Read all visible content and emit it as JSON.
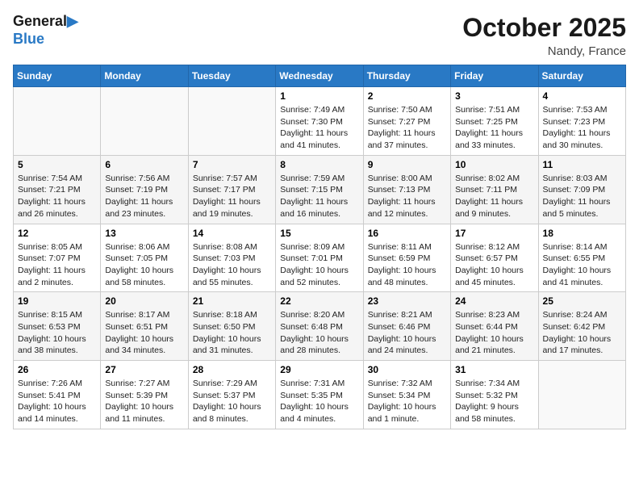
{
  "logo": {
    "line1": "General",
    "line2": "Blue"
  },
  "title": "October 2025",
  "subtitle": "Nandy, France",
  "days_header": [
    "Sunday",
    "Monday",
    "Tuesday",
    "Wednesday",
    "Thursday",
    "Friday",
    "Saturday"
  ],
  "weeks": [
    [
      {
        "day": "",
        "info": ""
      },
      {
        "day": "",
        "info": ""
      },
      {
        "day": "",
        "info": ""
      },
      {
        "day": "1",
        "info": "Sunrise: 7:49 AM\nSunset: 7:30 PM\nDaylight: 11 hours and 41 minutes."
      },
      {
        "day": "2",
        "info": "Sunrise: 7:50 AM\nSunset: 7:27 PM\nDaylight: 11 hours and 37 minutes."
      },
      {
        "day": "3",
        "info": "Sunrise: 7:51 AM\nSunset: 7:25 PM\nDaylight: 11 hours and 33 minutes."
      },
      {
        "day": "4",
        "info": "Sunrise: 7:53 AM\nSunset: 7:23 PM\nDaylight: 11 hours and 30 minutes."
      }
    ],
    [
      {
        "day": "5",
        "info": "Sunrise: 7:54 AM\nSunset: 7:21 PM\nDaylight: 11 hours and 26 minutes."
      },
      {
        "day": "6",
        "info": "Sunrise: 7:56 AM\nSunset: 7:19 PM\nDaylight: 11 hours and 23 minutes."
      },
      {
        "day": "7",
        "info": "Sunrise: 7:57 AM\nSunset: 7:17 PM\nDaylight: 11 hours and 19 minutes."
      },
      {
        "day": "8",
        "info": "Sunrise: 7:59 AM\nSunset: 7:15 PM\nDaylight: 11 hours and 16 minutes."
      },
      {
        "day": "9",
        "info": "Sunrise: 8:00 AM\nSunset: 7:13 PM\nDaylight: 11 hours and 12 minutes."
      },
      {
        "day": "10",
        "info": "Sunrise: 8:02 AM\nSunset: 7:11 PM\nDaylight: 11 hours and 9 minutes."
      },
      {
        "day": "11",
        "info": "Sunrise: 8:03 AM\nSunset: 7:09 PM\nDaylight: 11 hours and 5 minutes."
      }
    ],
    [
      {
        "day": "12",
        "info": "Sunrise: 8:05 AM\nSunset: 7:07 PM\nDaylight: 11 hours and 2 minutes."
      },
      {
        "day": "13",
        "info": "Sunrise: 8:06 AM\nSunset: 7:05 PM\nDaylight: 10 hours and 58 minutes."
      },
      {
        "day": "14",
        "info": "Sunrise: 8:08 AM\nSunset: 7:03 PM\nDaylight: 10 hours and 55 minutes."
      },
      {
        "day": "15",
        "info": "Sunrise: 8:09 AM\nSunset: 7:01 PM\nDaylight: 10 hours and 52 minutes."
      },
      {
        "day": "16",
        "info": "Sunrise: 8:11 AM\nSunset: 6:59 PM\nDaylight: 10 hours and 48 minutes."
      },
      {
        "day": "17",
        "info": "Sunrise: 8:12 AM\nSunset: 6:57 PM\nDaylight: 10 hours and 45 minutes."
      },
      {
        "day": "18",
        "info": "Sunrise: 8:14 AM\nSunset: 6:55 PM\nDaylight: 10 hours and 41 minutes."
      }
    ],
    [
      {
        "day": "19",
        "info": "Sunrise: 8:15 AM\nSunset: 6:53 PM\nDaylight: 10 hours and 38 minutes."
      },
      {
        "day": "20",
        "info": "Sunrise: 8:17 AM\nSunset: 6:51 PM\nDaylight: 10 hours and 34 minutes."
      },
      {
        "day": "21",
        "info": "Sunrise: 8:18 AM\nSunset: 6:50 PM\nDaylight: 10 hours and 31 minutes."
      },
      {
        "day": "22",
        "info": "Sunrise: 8:20 AM\nSunset: 6:48 PM\nDaylight: 10 hours and 28 minutes."
      },
      {
        "day": "23",
        "info": "Sunrise: 8:21 AM\nSunset: 6:46 PM\nDaylight: 10 hours and 24 minutes."
      },
      {
        "day": "24",
        "info": "Sunrise: 8:23 AM\nSunset: 6:44 PM\nDaylight: 10 hours and 21 minutes."
      },
      {
        "day": "25",
        "info": "Sunrise: 8:24 AM\nSunset: 6:42 PM\nDaylight: 10 hours and 17 minutes."
      }
    ],
    [
      {
        "day": "26",
        "info": "Sunrise: 7:26 AM\nSunset: 5:41 PM\nDaylight: 10 hours and 14 minutes."
      },
      {
        "day": "27",
        "info": "Sunrise: 7:27 AM\nSunset: 5:39 PM\nDaylight: 10 hours and 11 minutes."
      },
      {
        "day": "28",
        "info": "Sunrise: 7:29 AM\nSunset: 5:37 PM\nDaylight: 10 hours and 8 minutes."
      },
      {
        "day": "29",
        "info": "Sunrise: 7:31 AM\nSunset: 5:35 PM\nDaylight: 10 hours and 4 minutes."
      },
      {
        "day": "30",
        "info": "Sunrise: 7:32 AM\nSunset: 5:34 PM\nDaylight: 10 hours and 1 minute."
      },
      {
        "day": "31",
        "info": "Sunrise: 7:34 AM\nSunset: 5:32 PM\nDaylight: 9 hours and 58 minutes."
      },
      {
        "day": "",
        "info": ""
      }
    ]
  ]
}
